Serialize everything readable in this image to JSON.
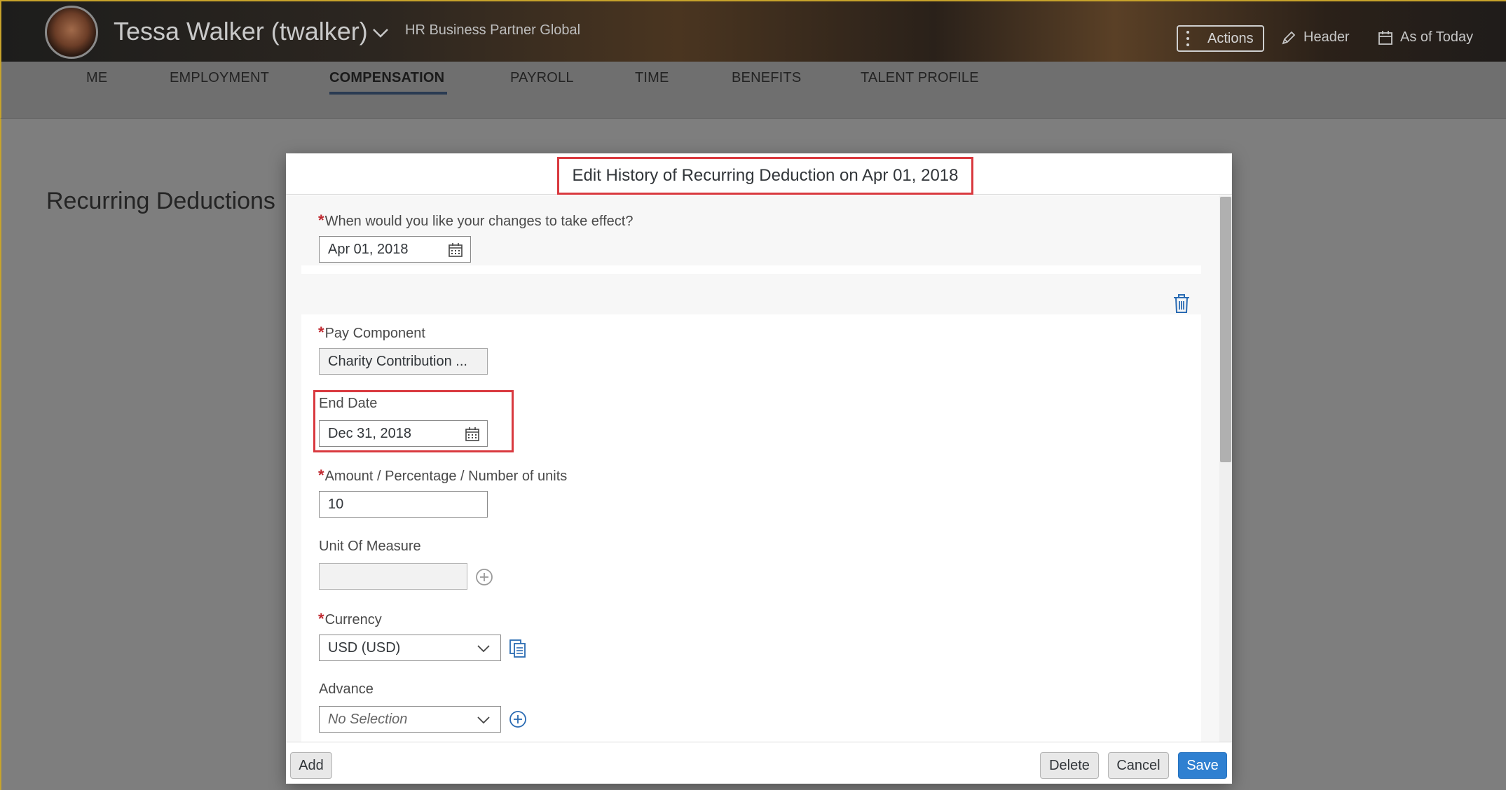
{
  "header": {
    "name": "Tessa Walker (twalker)",
    "role": "HR Business Partner Global",
    "actions_label": "Actions",
    "header_label": "Header",
    "as_of_label": "As of Today"
  },
  "nav": {
    "tabs": [
      {
        "label": "ME"
      },
      {
        "label": "EMPLOYMENT"
      },
      {
        "label": "COMPENSATION",
        "active": true
      },
      {
        "label": "PAYROLL"
      },
      {
        "label": "TIME"
      },
      {
        "label": "BENEFITS"
      },
      {
        "label": "TALENT PROFILE"
      }
    ]
  },
  "page": {
    "title": "Recurring Deductions"
  },
  "dialog": {
    "title": "Edit History of Recurring Deduction on Apr 01, 2018",
    "effective": {
      "label": "When would you like your changes to take effect?",
      "value": "Apr 01, 2018"
    },
    "pay_component": {
      "label": "Pay Component",
      "value": "Charity Contribution ..."
    },
    "end_date": {
      "label": "End Date",
      "value": "Dec 31, 2018"
    },
    "amount": {
      "label": "Amount / Percentage / Number of units",
      "value": "10"
    },
    "unit": {
      "label": "Unit Of Measure",
      "value": ""
    },
    "currency": {
      "label": "Currency",
      "value": "USD (USD)"
    },
    "advance": {
      "label": "Advance",
      "value": "No Selection"
    },
    "footer": {
      "add": "Add",
      "delete": "Delete",
      "cancel": "Cancel",
      "save": "Save"
    }
  },
  "colors": {
    "primary": "#2f80d1",
    "required": "#c0282f",
    "highlight": "#d9393f"
  }
}
